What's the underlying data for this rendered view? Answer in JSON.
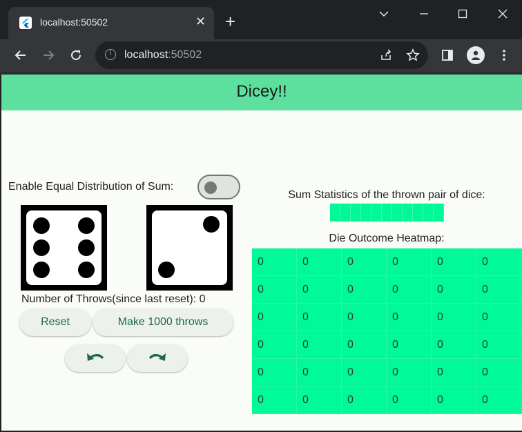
{
  "browser": {
    "tab_title": "localhost:50502",
    "url_host": "localhost",
    "url_port": ":50502"
  },
  "app": {
    "title": "Dicey!!",
    "equal_distribution_label": "Enable Equal Distribution of Sum:",
    "equal_distribution_enabled": false,
    "dice": [
      6,
      2
    ],
    "throws_label": "Number of Throws(since last reset): 0",
    "reset_label": "Reset",
    "make_throws_label": "Make 1000 throws",
    "undo_icon": "undo-icon",
    "redo_icon": "redo-icon",
    "sum_stats_label": "Sum Statistics of the thrown pair of dice:",
    "sum_stats_cells": 11,
    "heatmap_label": "Die Outcome Heatmap:",
    "heatmap": [
      [
        "0",
        "0",
        "0",
        "0",
        "0",
        "0"
      ],
      [
        "0",
        "0",
        "0",
        "0",
        "0",
        "0"
      ],
      [
        "0",
        "0",
        "0",
        "0",
        "0",
        "0"
      ],
      [
        "0",
        "0",
        "0",
        "0",
        "0",
        "0"
      ],
      [
        "0",
        "0",
        "0",
        "0",
        "0",
        "0"
      ],
      [
        "0",
        "0",
        "0",
        "0",
        "0",
        "0"
      ]
    ],
    "colors": {
      "appbar": "#5ddf9e",
      "heat_cell": "#00fa99",
      "button_text": "#1e6a47"
    }
  }
}
